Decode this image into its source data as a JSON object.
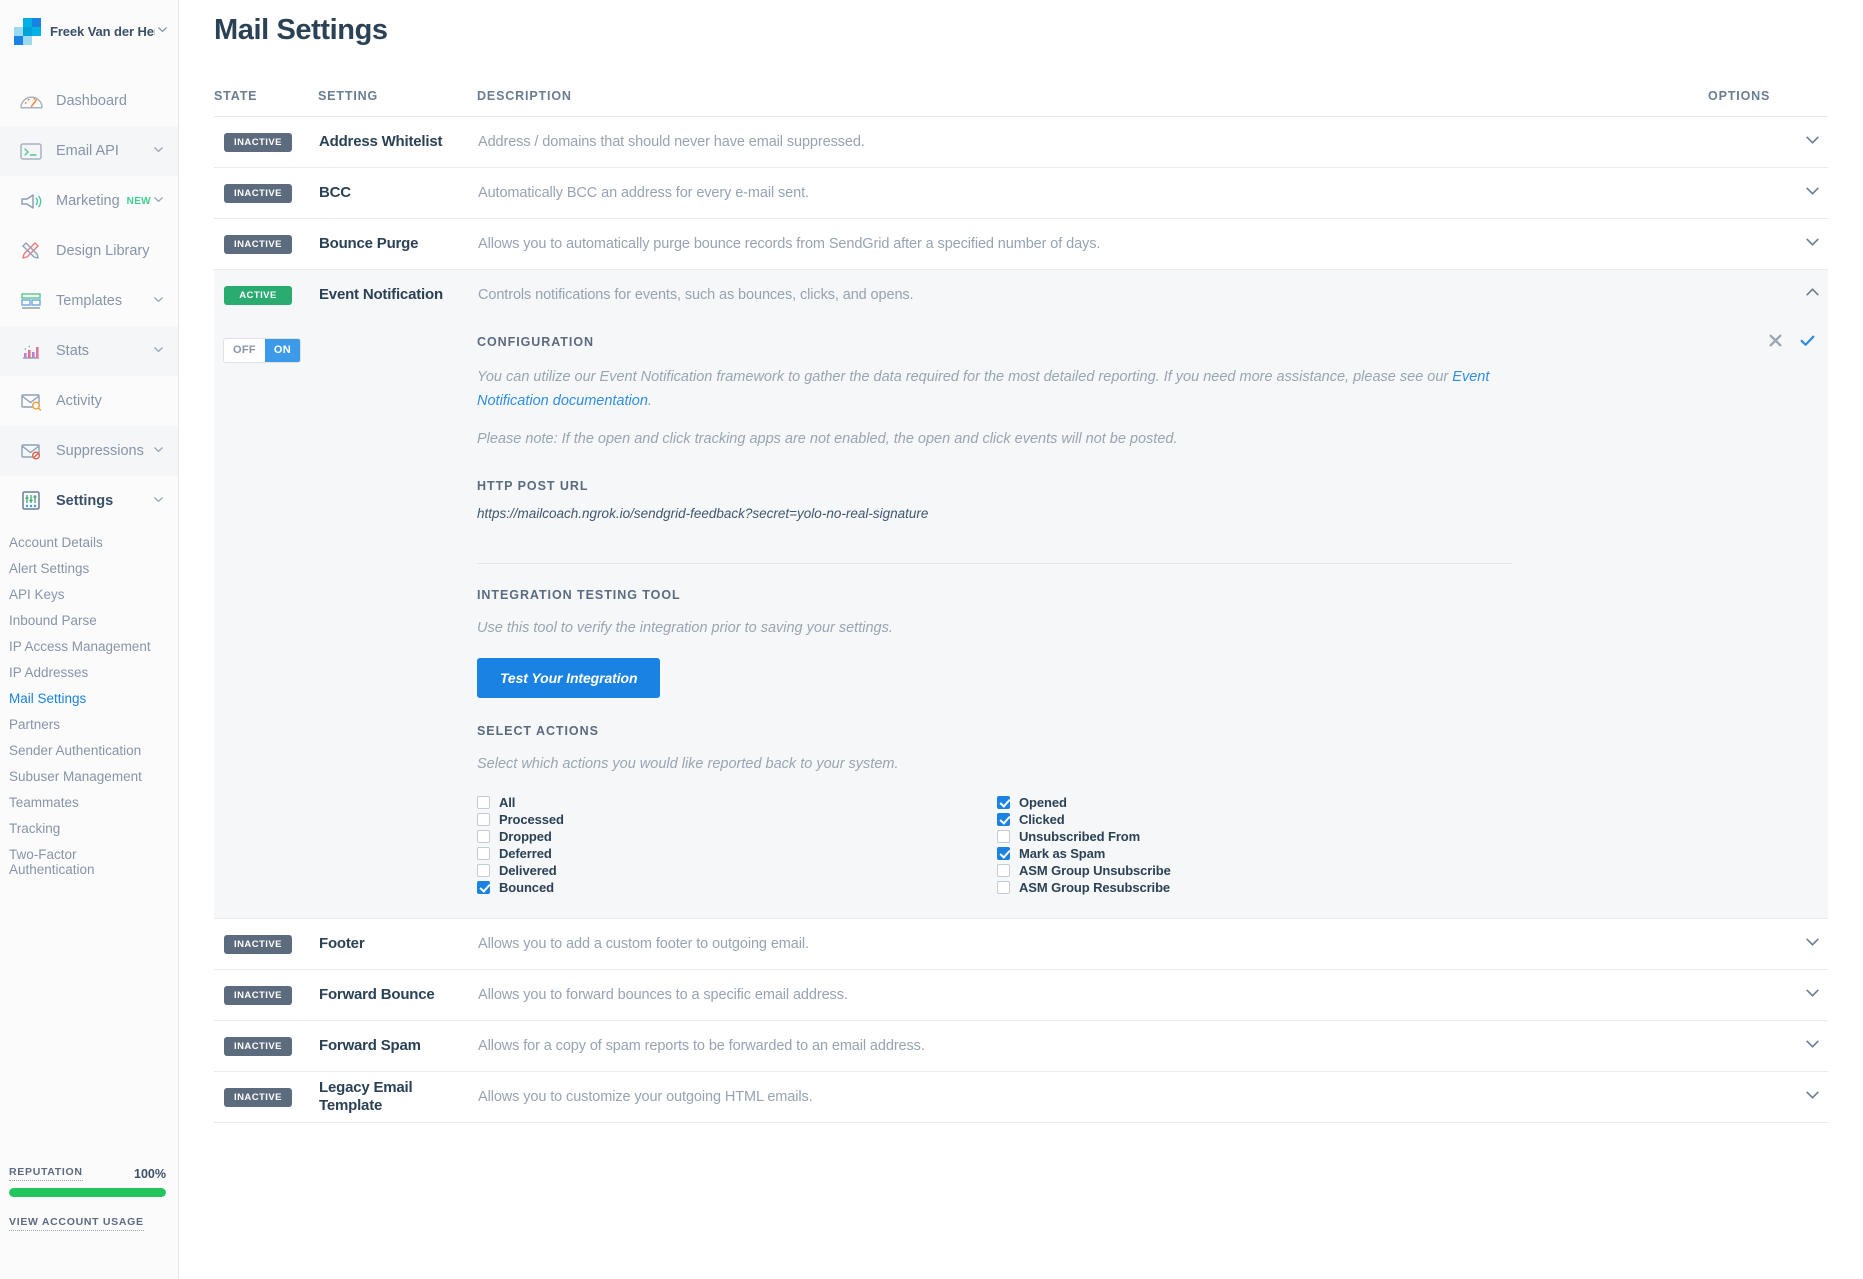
{
  "sidebar": {
    "brand": {
      "name": "Freek Van der Hert",
      "caret_icon": "chevron-down-icon"
    },
    "nav": [
      {
        "label": "Dashboard",
        "icon": "gauge-icon",
        "has_caret": false,
        "highlight": false
      },
      {
        "label": "Email API",
        "icon": "terminal-icon",
        "has_caret": true,
        "highlight": true
      },
      {
        "label": "Marketing",
        "icon": "megaphone-icon",
        "has_caret": true,
        "highlight": false,
        "badge": "NEW"
      },
      {
        "label": "Design Library",
        "icon": "pencil-ruler-icon",
        "has_caret": false,
        "highlight": false
      },
      {
        "label": "Templates",
        "icon": "template-icon",
        "has_caret": true,
        "highlight": false
      },
      {
        "label": "Stats",
        "icon": "bar-chart-icon",
        "has_caret": true,
        "highlight": true
      },
      {
        "label": "Activity",
        "icon": "envelope-search-icon",
        "has_caret": false,
        "highlight": false
      },
      {
        "label": "Suppressions",
        "icon": "envelope-block-icon",
        "has_caret": true,
        "highlight": true
      },
      {
        "label": "Settings",
        "icon": "sliders-icon",
        "has_caret": true,
        "highlight": false,
        "is_section": true
      }
    ],
    "subnav": [
      {
        "label": "Account Details",
        "current": false
      },
      {
        "label": "Alert Settings",
        "current": false
      },
      {
        "label": "API Keys",
        "current": false
      },
      {
        "label": "Inbound Parse",
        "current": false
      },
      {
        "label": "IP Access Management",
        "current": false
      },
      {
        "label": "IP Addresses",
        "current": false
      },
      {
        "label": "Mail Settings",
        "current": true
      },
      {
        "label": "Partners",
        "current": false
      },
      {
        "label": "Sender Authentication",
        "current": false
      },
      {
        "label": "Subuser Management",
        "current": false
      },
      {
        "label": "Teammates",
        "current": false
      },
      {
        "label": "Tracking",
        "current": false
      },
      {
        "label": "Two-Factor Authentication",
        "current": false
      }
    ],
    "reputation": {
      "label": "REPUTATION",
      "percent": "100%",
      "fill": 100,
      "color": "#22c55e"
    },
    "account_usage_link": "VIEW ACCOUNT USAGE"
  },
  "page": {
    "title": "Mail Settings"
  },
  "table": {
    "headers": {
      "state": "STATE",
      "setting": "SETTING",
      "description": "DESCRIPTION",
      "options": "OPTIONS"
    },
    "rows": [
      {
        "state": "INACTIVE",
        "name": "Address Whitelist",
        "description": "Address / domains that should never have email suppressed.",
        "expanded": false
      },
      {
        "state": "INACTIVE",
        "name": "BCC",
        "description": "Automatically BCC an address for every e-mail sent.",
        "expanded": false
      },
      {
        "state": "INACTIVE",
        "name": "Bounce Purge",
        "description": "Allows you to automatically purge bounce records from SendGrid after a specified number of days.",
        "expanded": false
      },
      {
        "state": "ACTIVE",
        "name": "Event Notification",
        "description": "Controls notifications for events, such as bounces, clicks, and opens.",
        "expanded": true
      },
      {
        "state": "INACTIVE",
        "name": "Footer",
        "description": "Allows you to add a custom footer to outgoing email.",
        "expanded": false
      },
      {
        "state": "INACTIVE",
        "name": "Forward Bounce",
        "description": "Allows you to forward bounces to a specific email address.",
        "expanded": false
      },
      {
        "state": "INACTIVE",
        "name": "Forward Spam",
        "description": "Allows for a copy of spam reports to be forwarded to an email address.",
        "expanded": false
      },
      {
        "state": "INACTIVE",
        "name": "Legacy Email Template",
        "description": "Allows you to customize your outgoing HTML emails.",
        "expanded": false
      }
    ]
  },
  "panel": {
    "toggle": {
      "off_label": "OFF",
      "on_label": "ON",
      "state": "ON"
    },
    "configuration_heading": "CONFIGURATION",
    "intro_text_before_link": "You can utilize our Event Notification framework to gather the data required for the most detailed reporting. If you need more assistance, please see our ",
    "intro_link_text": "Event Notification documentation",
    "intro_text_after_link": ".",
    "note": "Please note: If the open and click tracking apps are not enabled, the open and click events will not be posted.",
    "http_post_url_heading": "HTTP POST URL",
    "http_post_url": "https://mailcoach.ngrok.io/sendgrid-feedback?secret=yolo-no-real-signature",
    "testing_heading": "INTEGRATION TESTING TOOL",
    "testing_desc": "Use this tool to verify the integration prior to saving your settings.",
    "test_button": "Test Your Integration",
    "actions_heading": "SELECT ACTIONS",
    "actions_desc": "Select which actions you would like reported back to your system.",
    "actions_left": [
      {
        "label": "All",
        "checked": false
      },
      {
        "label": "Processed",
        "checked": false
      },
      {
        "label": "Dropped",
        "checked": false
      },
      {
        "label": "Deferred",
        "checked": false
      },
      {
        "label": "Delivered",
        "checked": false
      },
      {
        "label": "Bounced",
        "checked": true
      }
    ],
    "actions_right": [
      {
        "label": "Opened",
        "checked": true
      },
      {
        "label": "Clicked",
        "checked": true
      },
      {
        "label": "Unsubscribed From",
        "checked": false
      },
      {
        "label": "Mark as Spam",
        "checked": true
      },
      {
        "label": "ASM Group Unsubscribe",
        "checked": false
      },
      {
        "label": "ASM Group Resubscribe",
        "checked": false
      }
    ],
    "cancel_icon": "close-icon",
    "confirm_icon": "check-icon"
  },
  "colors": {
    "accent_blue": "#1a82e2",
    "active_green": "#2aab70",
    "inactive_gray": "#5c6b7e",
    "title_navy": "#2b4256",
    "reputation_green": "#22c55e"
  }
}
